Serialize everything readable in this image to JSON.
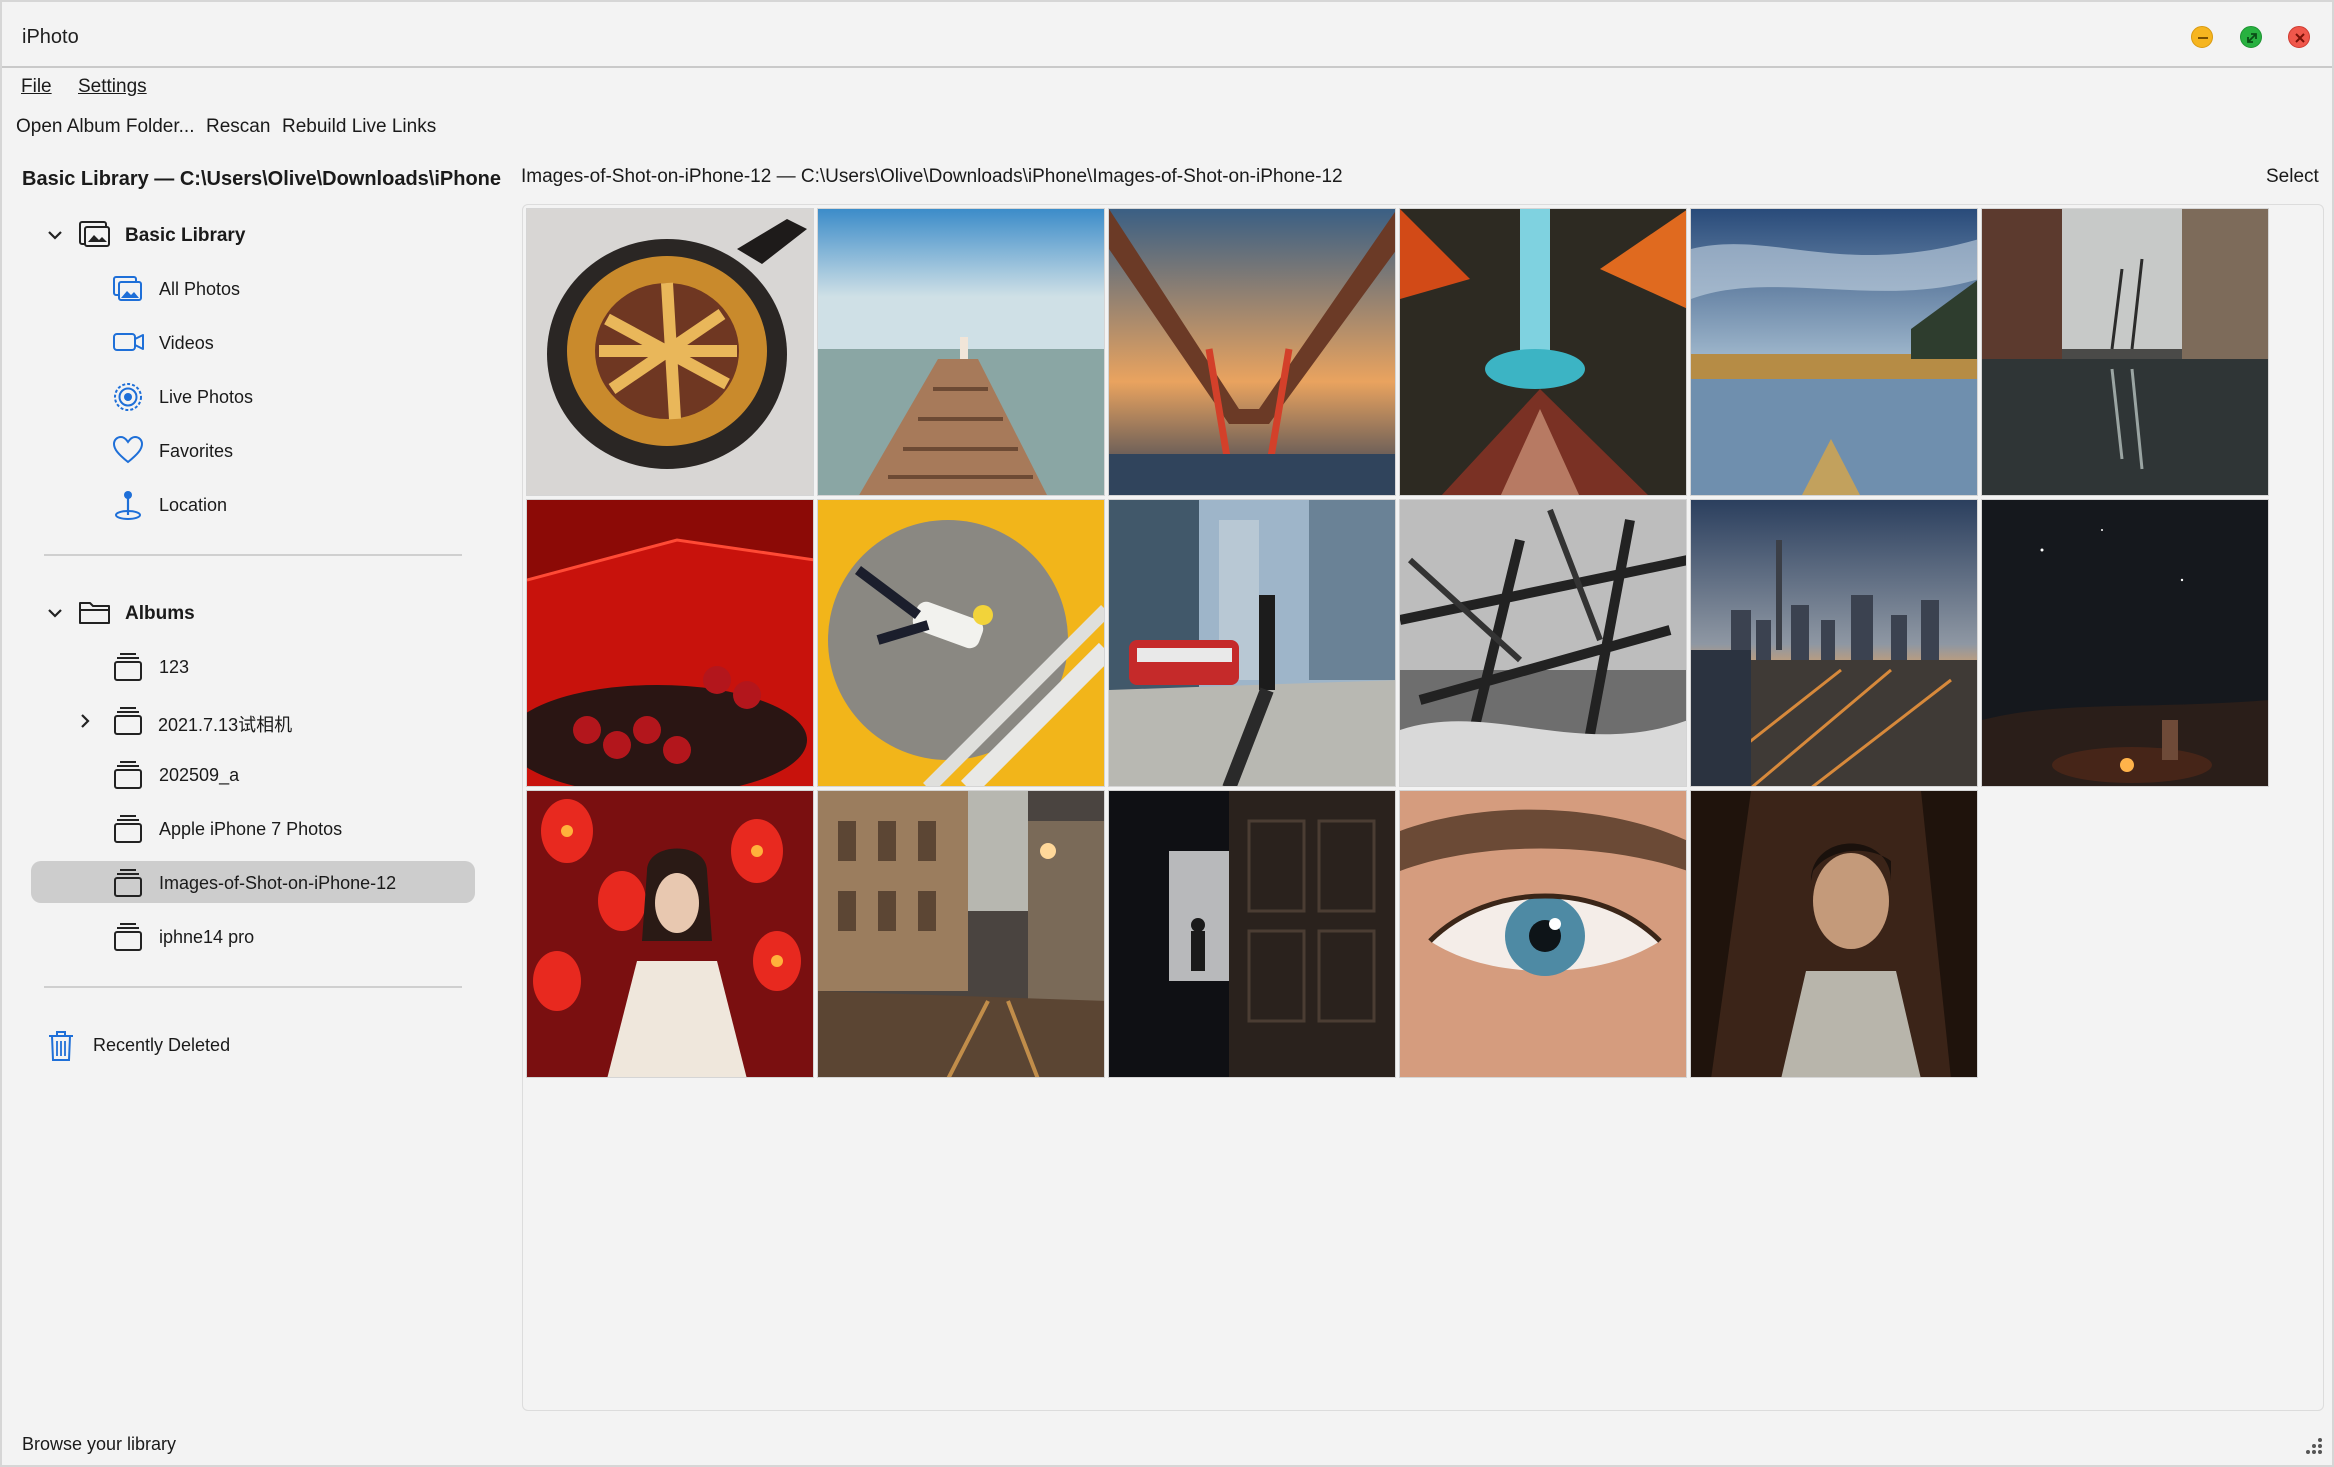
{
  "window": {
    "title": "iPhoto"
  },
  "menu": {
    "file": "File",
    "settings": "Settings"
  },
  "toolbar": {
    "open_album_folder": "Open Album Folder...",
    "rescan": "Rescan",
    "rebuild_live_links": "Rebuild Live Links"
  },
  "sidebar": {
    "library_header": "Basic Library — C:\\Users\\Olive\\Downloads\\iPhone",
    "library": {
      "label": "Basic Library",
      "items": [
        {
          "label": "All Photos",
          "icon": "photos-icon"
        },
        {
          "label": "Videos",
          "icon": "video-icon"
        },
        {
          "label": "Live Photos",
          "icon": "live-photo-icon"
        },
        {
          "label": "Favorites",
          "icon": "heart-icon"
        },
        {
          "label": "Location",
          "icon": "location-pin-icon"
        }
      ]
    },
    "albums": {
      "label": "Albums",
      "items": [
        {
          "label": "123"
        },
        {
          "label": "2021.7.13试相机",
          "expandable": true
        },
        {
          "label": "202509_a"
        },
        {
          "label": "Apple iPhone 7 Photos"
        },
        {
          "label": "Images-of-Shot-on-iPhone-12",
          "selected": true
        },
        {
          "label": "iphne14 pro"
        }
      ]
    },
    "recently_deleted": "Recently Deleted"
  },
  "content": {
    "path": "Images-of-Shot-on-iPhone-12 — C:\\Users\\Olive\\Downloads\\iPhone\\Images-of-Shot-on-iPhone-12",
    "select_label": "Select",
    "photos": [
      "pie-photo",
      "pier-photo",
      "bridge-photo",
      "waterfall-photo",
      "lake-photo",
      "street-reflection-photo",
      "red-tent-photo",
      "person-on-yellow-photo",
      "tram-city-photo",
      "bw-branches-photo",
      "dubai-skyline-photo",
      "night-campfire-photo",
      "lanterns-portrait-photo",
      "old-street-photo",
      "dark-doorway-photo",
      "eye-closeup-photo",
      "shadow-portrait-photo"
    ]
  },
  "status": {
    "text": "Browse your library"
  },
  "colors": {
    "accent": "#1e6fd8",
    "selection": "#cdcdcd",
    "background": "#f3f3f3"
  }
}
